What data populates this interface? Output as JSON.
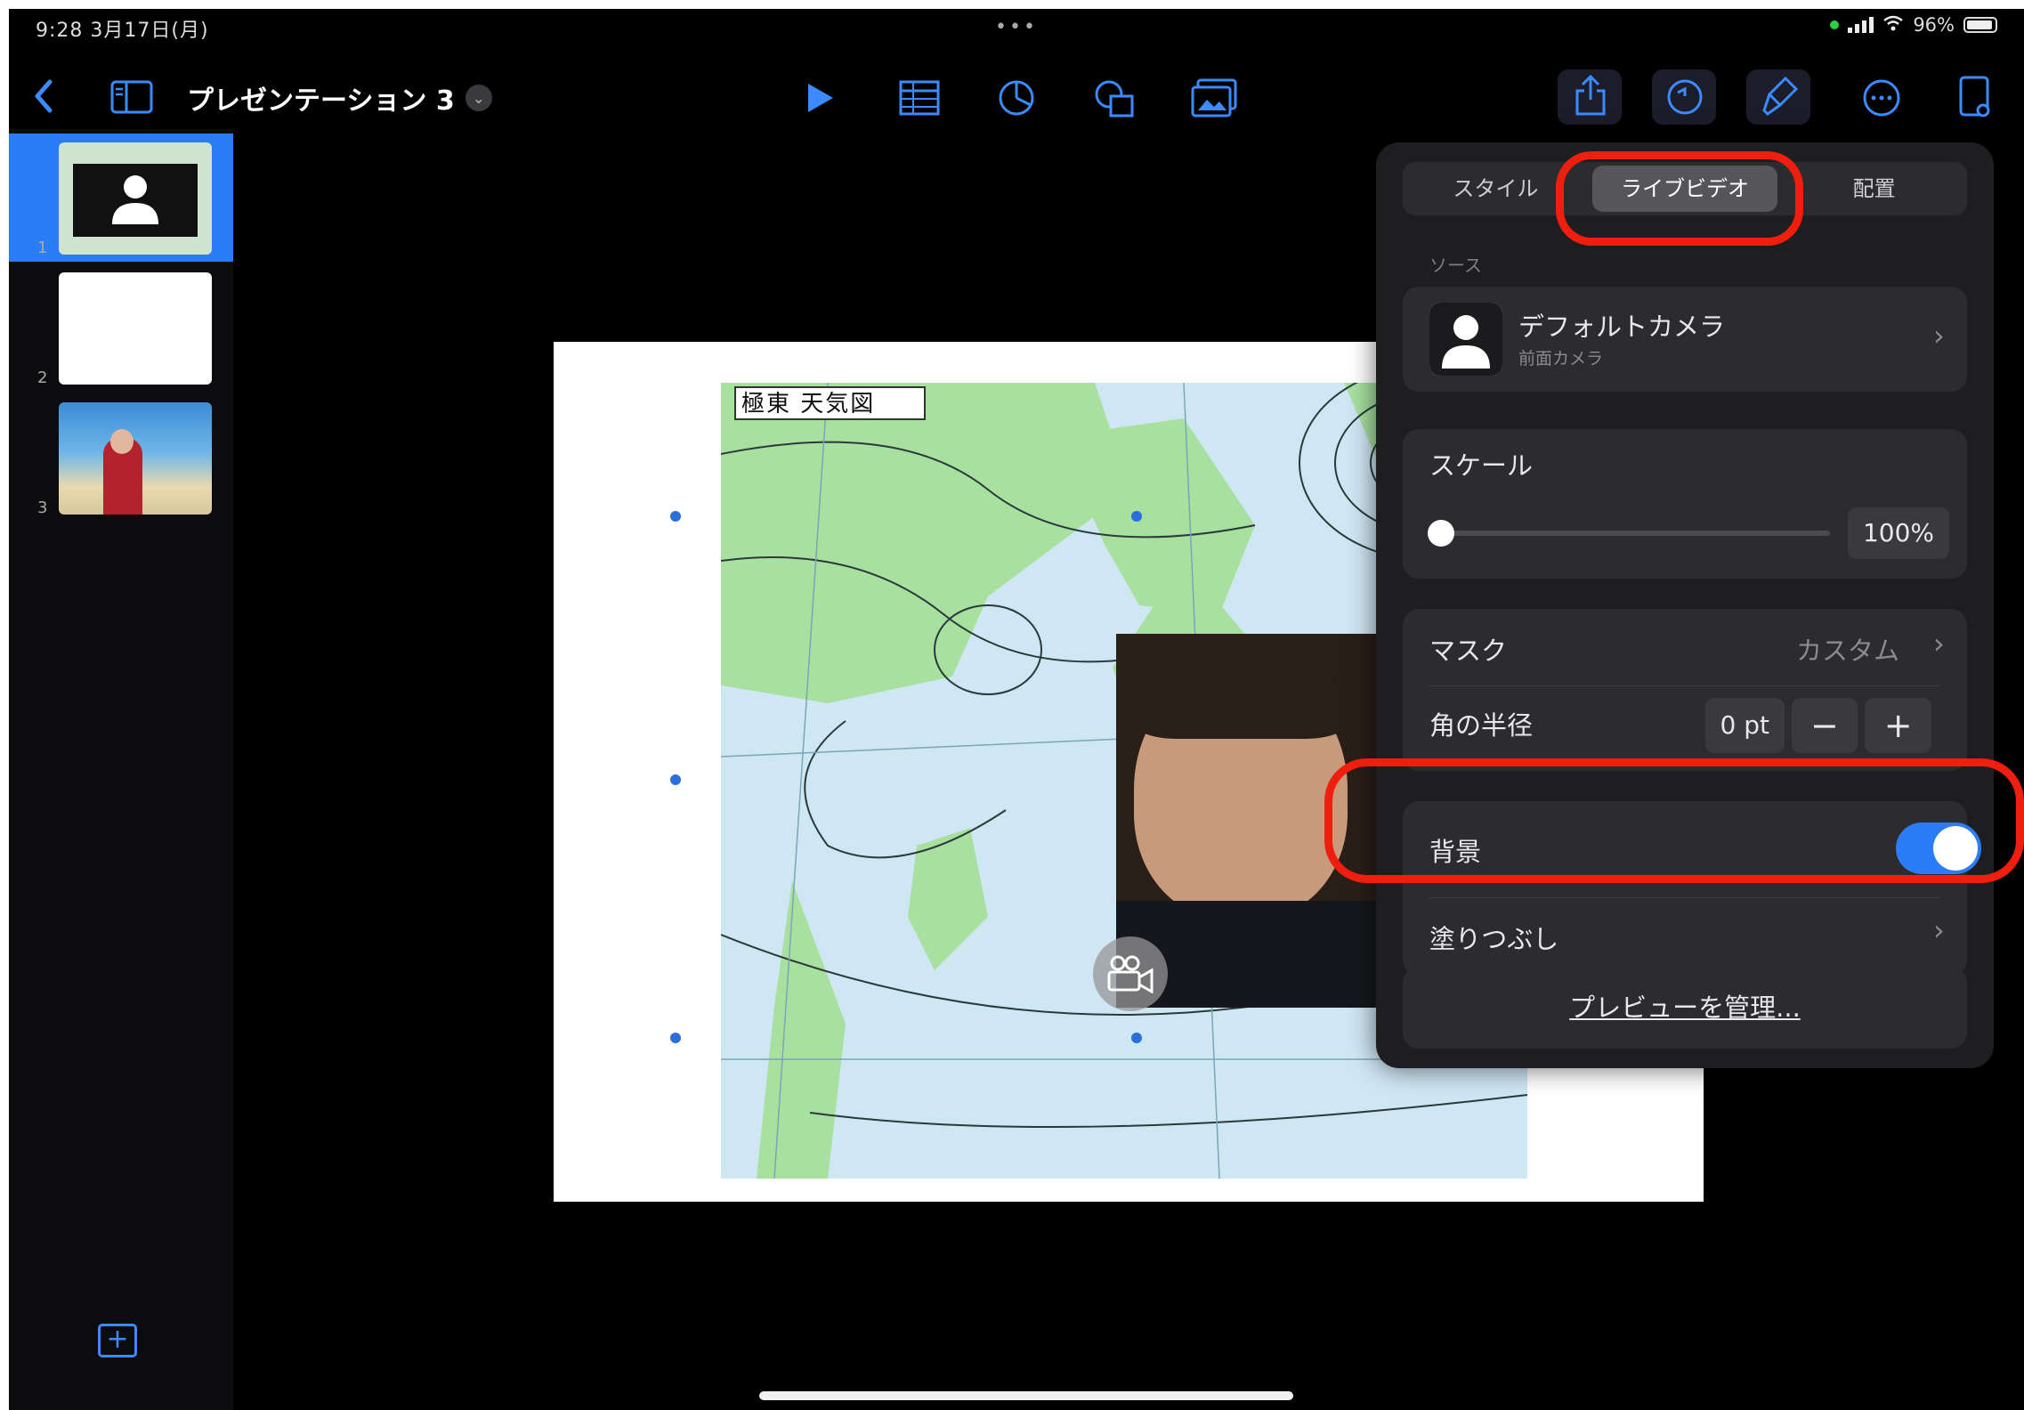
{
  "status_bar": {
    "time": "9:28  3月17日(月)",
    "multitask_dots": "•••",
    "battery_text": "96%"
  },
  "toolbar": {
    "back_icon": "chevron-left-icon",
    "sidebar_icon": "sidebar-icon",
    "document_title": "プレゼンテーション 3",
    "title_chevron": "⌄",
    "center_icons": [
      "play-icon",
      "table-icon",
      "chart-icon",
      "shapes-icon",
      "media-icon"
    ],
    "right_icons": [
      "share-icon",
      "undo-icon",
      "format-brush-icon",
      "more-icon",
      "document-icon"
    ],
    "accent_color": "#3b8bff"
  },
  "sidebar": {
    "slides": [
      {
        "number": "1",
        "selected": true
      },
      {
        "number": "2",
        "selected": false
      },
      {
        "number": "3",
        "selected": false
      }
    ],
    "selection_color": "#2a7cf7",
    "add_slide_label": "+"
  },
  "slide": {
    "map_title": "極東 天気図"
  },
  "popover": {
    "tabs": [
      {
        "label": "スタイル",
        "active": false
      },
      {
        "label": "ライブビデオ",
        "active": true
      },
      {
        "label": "配置",
        "active": false
      }
    ],
    "source_label": "ソース",
    "source": {
      "title": "デフォルトカメラ",
      "subtitle": "前面カメラ"
    },
    "scale": {
      "label": "スケール",
      "value": "100%",
      "slider_level": 0
    },
    "mask": {
      "label": "マスク",
      "value": "カスタム"
    },
    "corner_radius": {
      "label": "角の半径",
      "value": "0 pt",
      "minus": "−",
      "plus": "+"
    },
    "background": {
      "label": "背景",
      "on": true
    },
    "fill": {
      "label": "塗りつぶし"
    },
    "manage_preview": "プレビューを管理...",
    "toggle_color": "#2a7cf7",
    "highlight_color": "#f01e0f"
  }
}
